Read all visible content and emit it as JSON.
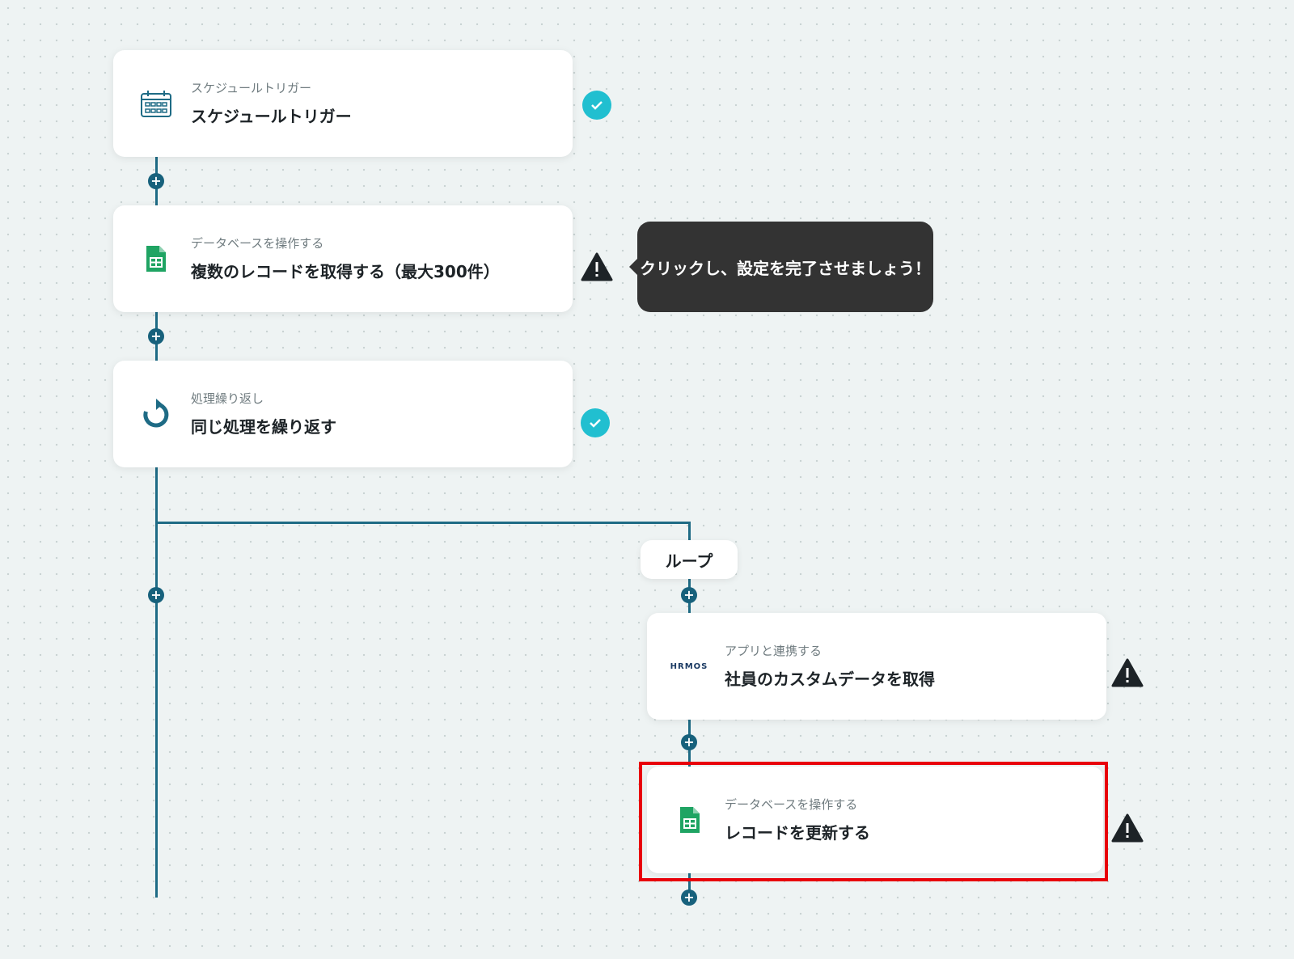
{
  "steps": [
    {
      "subtitle": "スケジュールトリガー",
      "title": "スケジュールトリガー",
      "icon": "calendar-icon",
      "status": "complete"
    },
    {
      "subtitle": "データベースを操作する",
      "title": "複数のレコードを取得する（最大300件）",
      "icon": "google-sheets-icon",
      "status": "warning"
    },
    {
      "subtitle": "処理繰り返し",
      "title": "同じ処理を繰り返す",
      "icon": "loop-icon",
      "status": "complete"
    },
    {
      "subtitle": "アプリと連携する",
      "title": "社員のカスタムデータを取得",
      "icon": "hrmos-logo-icon",
      "status": "warning",
      "logo_text": "HRMOS"
    },
    {
      "subtitle": "データベースを操作する",
      "title": "レコードを更新する",
      "icon": "google-sheets-icon",
      "status": "warning"
    }
  ],
  "tooltip": {
    "text": "クリックし、設定を完了させましょう！"
  },
  "loop_label": "ループ",
  "colors": {
    "connector": "#1e6b85",
    "check": "#21bfd0",
    "highlight": "#e8000a",
    "tooltip_bg": "#333333"
  }
}
